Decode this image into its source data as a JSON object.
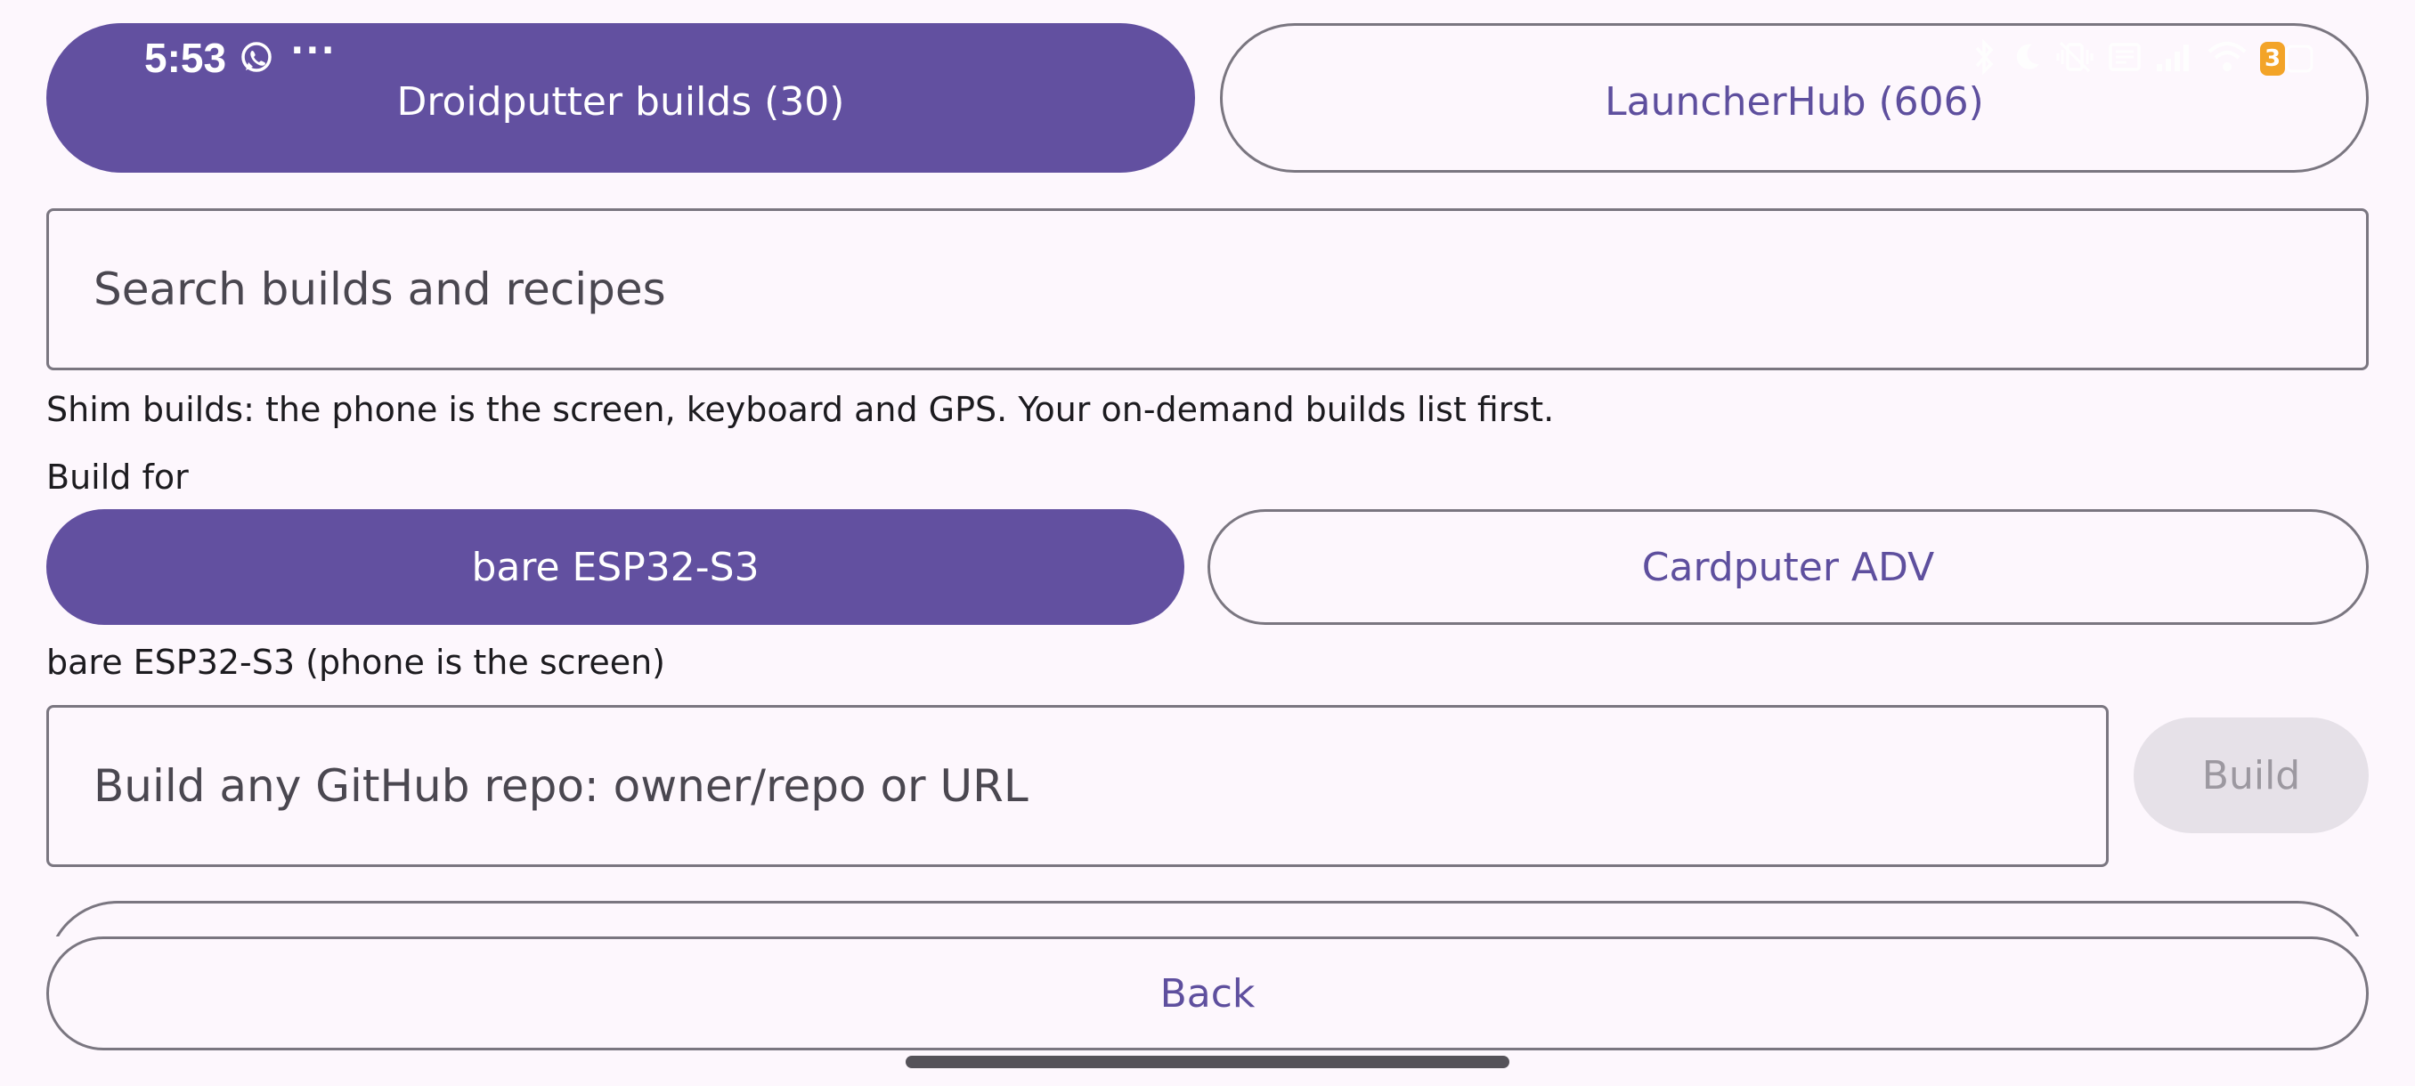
{
  "status_bar": {
    "time": "5:53",
    "more": "···",
    "battery_level": "3"
  },
  "tabs": [
    {
      "label": "Droidputter builds (30)",
      "selected": true
    },
    {
      "label": "LauncherHub (606)",
      "selected": false
    }
  ],
  "search": {
    "placeholder": "Search builds and recipes"
  },
  "info_text": "Shim builds: the phone is the screen, keyboard and GPS. Your on-demand builds list first.",
  "build_for": {
    "label": "Build for",
    "options": [
      {
        "label": "bare ESP32-S3",
        "selected": true
      },
      {
        "label": "Cardputer ADV",
        "selected": false
      }
    ],
    "selected_description": "bare ESP32-S3 (phone is the screen)"
  },
  "repo_build": {
    "placeholder": "Build any GitHub repo: owner/repo or URL",
    "button_label": "Build",
    "button_enabled": false
  },
  "footer": {
    "back_label": "Back"
  },
  "colors": {
    "primary": "#6250a0",
    "outline": "#7a7680",
    "background": "#fdf7fd",
    "disabled_bg": "#e6e1e8",
    "battery": "#f39c12"
  }
}
